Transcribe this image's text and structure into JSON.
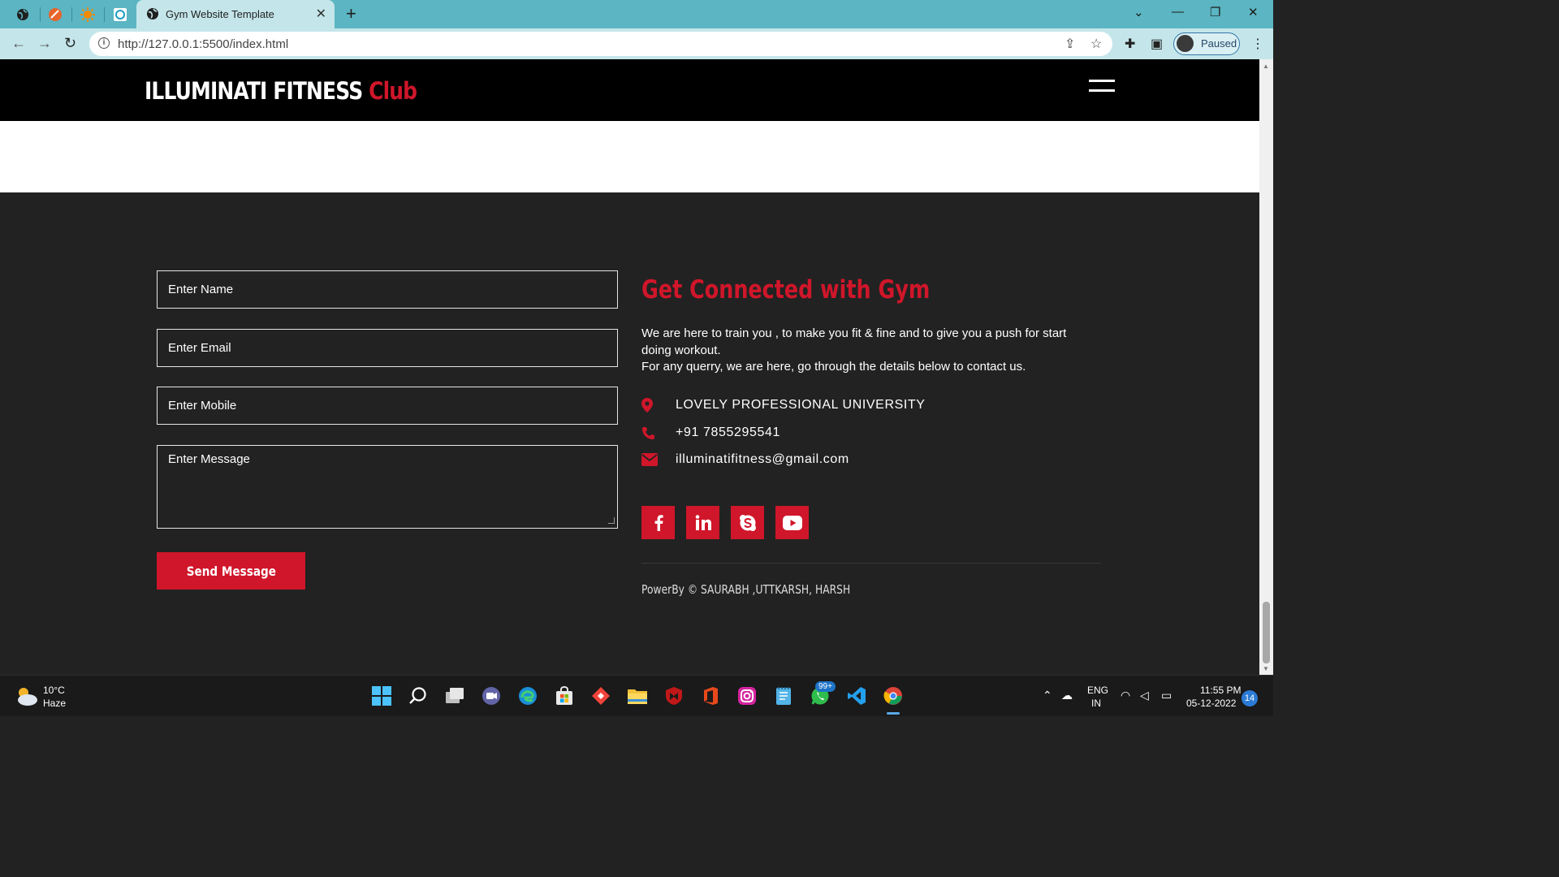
{
  "browser": {
    "tab_title": "Gym Website Template",
    "tab_close": "✕",
    "new_tab": "+",
    "url": "http://127.0.0.1:5500/index.html",
    "profile_label": "Paused",
    "window_controls": [
      "⌄",
      "—",
      "❐",
      "✕"
    ]
  },
  "site": {
    "logo_main": "ILLUMINATI FITNESS",
    "logo_accent": "Club",
    "accent_color": "#d0162a"
  },
  "form": {
    "name_placeholder": "Enter Name",
    "email_placeholder": "Enter Email",
    "mobile_placeholder": "Enter Mobile",
    "message_placeholder": "Enter Message",
    "submit_label": "Send Message"
  },
  "info": {
    "title": "Get Connected with Gym",
    "description_line1": "We are here to train you , to make you fit & fine and to give you a push for start doing workout.",
    "description_line2": "For any querry, we are here, go through the details below to contact us.",
    "address": "LOVELY PROFESSIONAL UNIVERSITY",
    "phone": "+91 7855295541",
    "email": "illuminatifitness@gmail.com",
    "social": [
      "facebook-icon",
      "linkedin-icon",
      "skype-icon",
      "youtube-icon"
    ],
    "powered_by": "PowerBy © SAURABH ,UTTKARSH, HARSH"
  },
  "taskbar": {
    "weather_temp": "10°C",
    "weather_cond": "Haze",
    "whatsapp_badge": "99+",
    "lang_line1": "ENG",
    "lang_line2": "IN",
    "time": "11:55 PM",
    "date": "05-12-2022",
    "notifications": "14"
  }
}
